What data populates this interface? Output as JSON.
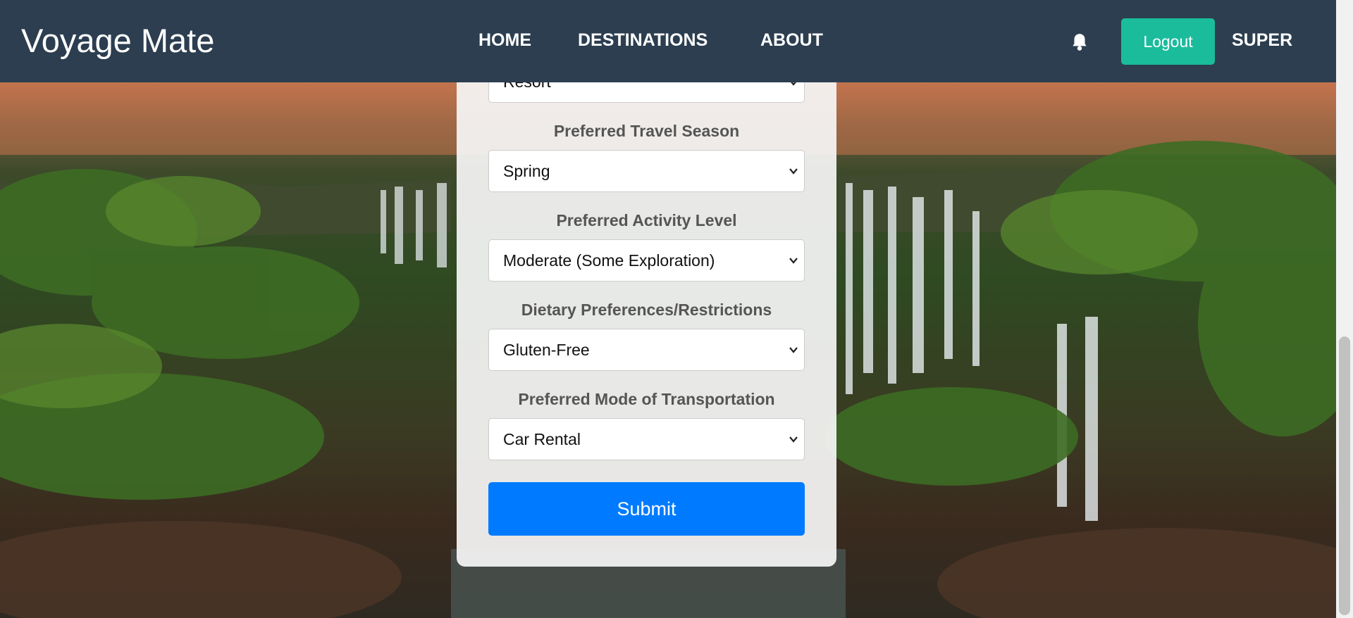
{
  "brand": "Voyage Mate",
  "nav": {
    "home": "HOME",
    "destinations": "DESTINATIONS",
    "about": "ABOUT"
  },
  "header": {
    "bell_icon": "bell-icon",
    "logout_label": "Logout",
    "username": "SUPER",
    "accent": "#1abc9c",
    "bar_color": "#2c3e50"
  },
  "form": {
    "accommodation_value": "Resort",
    "season_label": "Preferred Travel Season",
    "season_value": "Spring",
    "activity_label": "Preferred Activity Level",
    "activity_value": "Moderate (Some Exploration)",
    "dietary_label": "Dietary Preferences/Restrictions",
    "dietary_value": "Gluten-Free",
    "transport_label": "Preferred Mode of Transportation",
    "transport_value": "Car Rental",
    "submit_label": "Submit",
    "submit_color": "#007bff"
  }
}
